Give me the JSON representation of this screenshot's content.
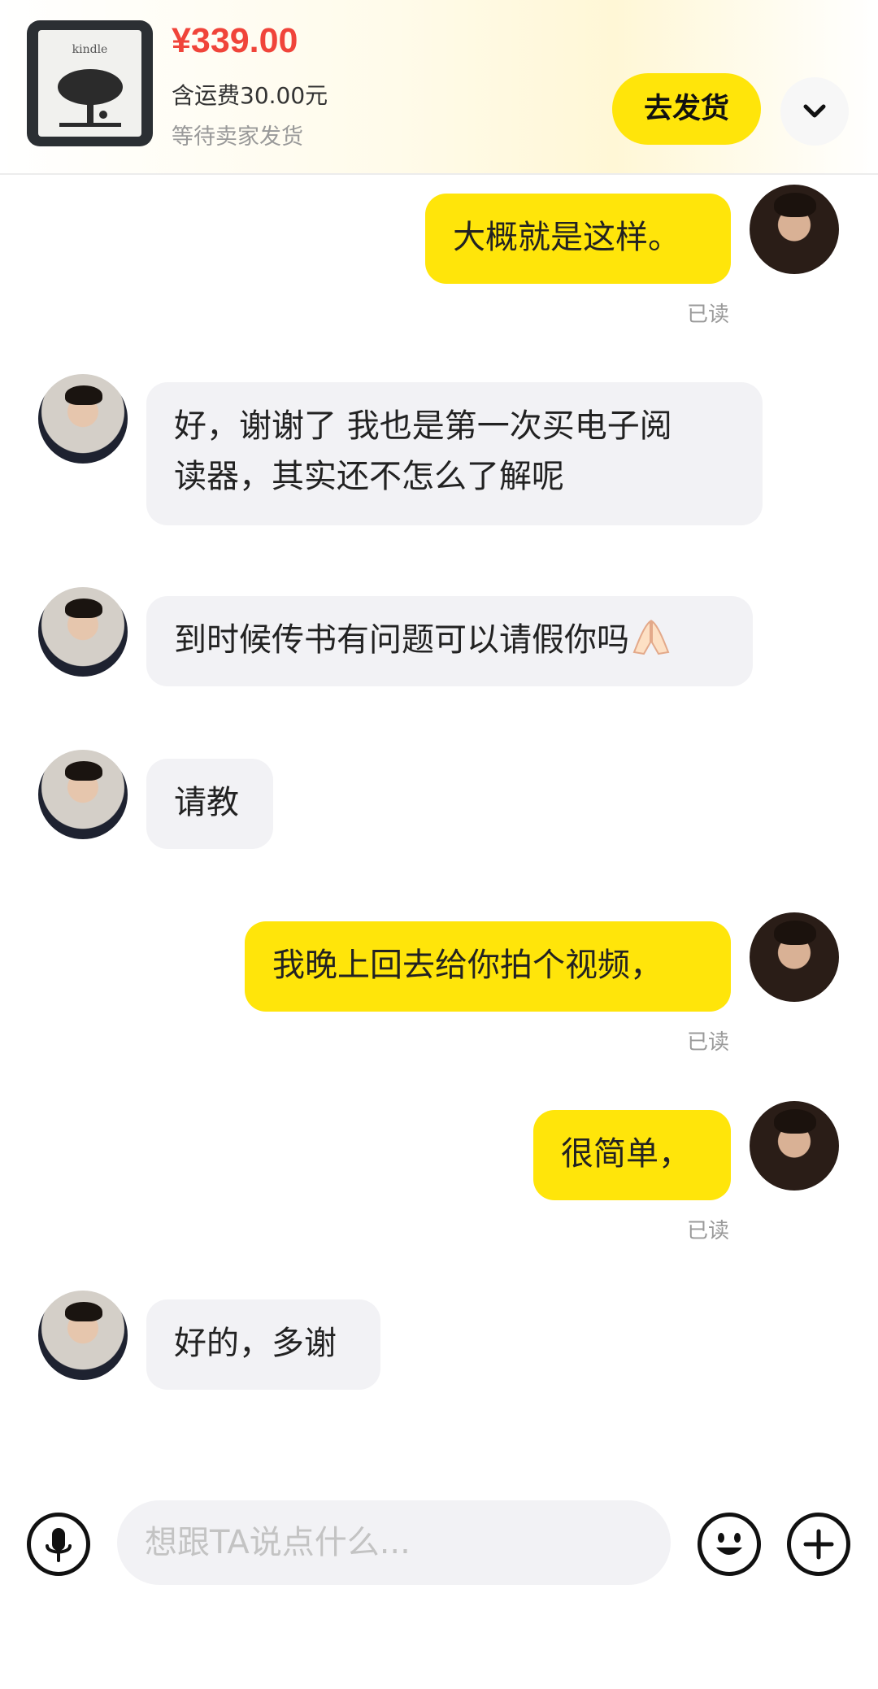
{
  "order": {
    "price": "¥339.00",
    "shipping_note": "含运费30.00元",
    "status": "等待卖家发货",
    "ship_button": "去发货",
    "product_brand_text": "kindle"
  },
  "messages": [
    {
      "side": "me",
      "text": "大概就是这样。",
      "receipt": "已读"
    },
    {
      "side": "peer",
      "line1": "好，谢谢了 我也是第一次买电子阅",
      "line2": "读器，其实还不怎么了解呢"
    },
    {
      "side": "peer",
      "text": "到时候传书有问题可以请假你吗"
    },
    {
      "side": "peer",
      "text": "请教"
    },
    {
      "side": "me",
      "text": "我晚上回去给你拍个视频，",
      "receipt": "已读"
    },
    {
      "side": "me",
      "text": "很简单，",
      "receipt": "已读"
    },
    {
      "side": "peer",
      "text": "好的，多谢"
    }
  ],
  "composer": {
    "placeholder": "想跟TA说点什么..."
  },
  "colors": {
    "accent_yellow": "#ffe50a",
    "price_red": "#f0443a",
    "peer_bubble": "#f2f2f5"
  },
  "icons": {
    "expand": "chevron-down-icon",
    "voice": "microphone-icon",
    "emoji": "smiley-icon",
    "more": "plus-icon",
    "emoji_in_message": "folded-hands-emoji"
  }
}
